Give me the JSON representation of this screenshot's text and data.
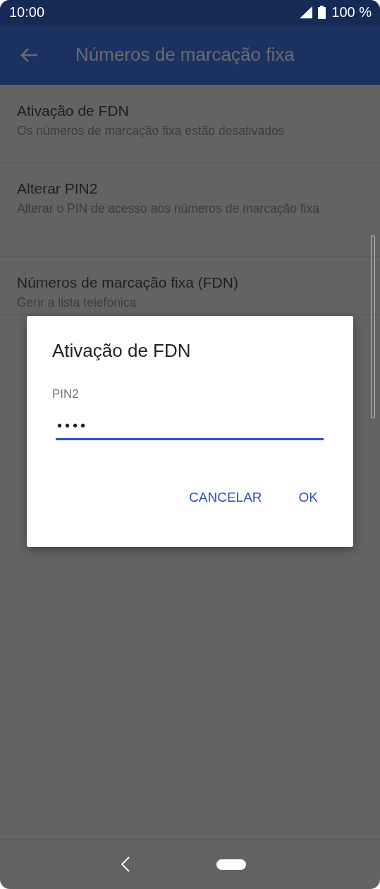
{
  "status_bar": {
    "time": "10:00",
    "battery": "100 %"
  },
  "app_bar": {
    "title": "Números de marcação fixa"
  },
  "settings": [
    {
      "title": "Ativação de FDN",
      "summary": "Os números de marcação fixa estão desativados"
    },
    {
      "title": "Alterar PIN2",
      "summary": "Alterar o PIN de acesso aos números de marcação fixa"
    },
    {
      "title": "Números de marcação fixa (FDN)",
      "summary": "Gerir a lista telefónica"
    }
  ],
  "dialog": {
    "title": "Ativação de FDN",
    "field": {
      "label": "PIN2",
      "value": "••••"
    },
    "buttons": [
      "CANCELAR",
      "OK"
    ]
  }
}
